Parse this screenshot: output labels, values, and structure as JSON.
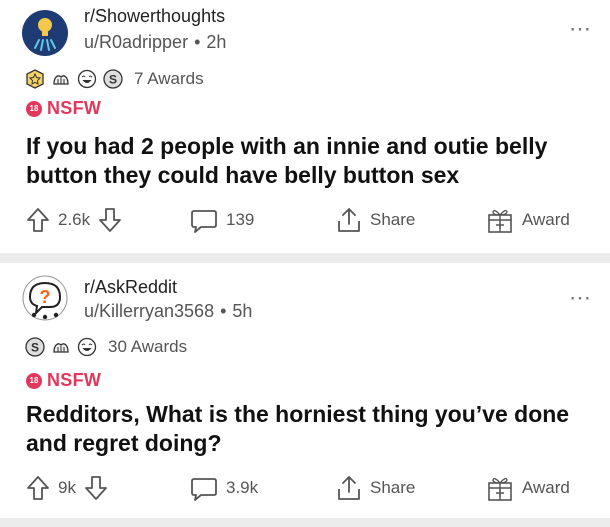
{
  "posts": [
    {
      "subreddit": "r/Showerthoughts",
      "user": "u/R0adripper",
      "age": "2h",
      "awards_count": "7 Awards",
      "nsfw_label": "NSFW",
      "nsfw_badge": "18",
      "title": "If you had 2 people with an innie and outie belly button they could have belly button sex",
      "votes": "2.6k",
      "comments": "139",
      "share_label": "Share",
      "award_label": "Award",
      "award_icons": [
        "gold-badge-icon",
        "hands-icon",
        "laughing-face-icon",
        "silver-award-icon"
      ]
    },
    {
      "subreddit": "r/AskReddit",
      "user": "u/Killerryan3568",
      "age": "5h",
      "awards_count": "30 Awards",
      "nsfw_label": "NSFW",
      "nsfw_badge": "18",
      "title": "Redditors, What is the horniest thing you’ve done and regret doing?",
      "votes": "9k",
      "comments": "3.9k",
      "share_label": "Share",
      "award_label": "Award",
      "award_icons": [
        "silver-award-icon",
        "hands-icon",
        "laughing-face-icon"
      ]
    }
  ],
  "colors": {
    "nsfw": "#e2375a",
    "showerthoughts_avatar": "#1f3b73",
    "divider": "#ececec"
  }
}
